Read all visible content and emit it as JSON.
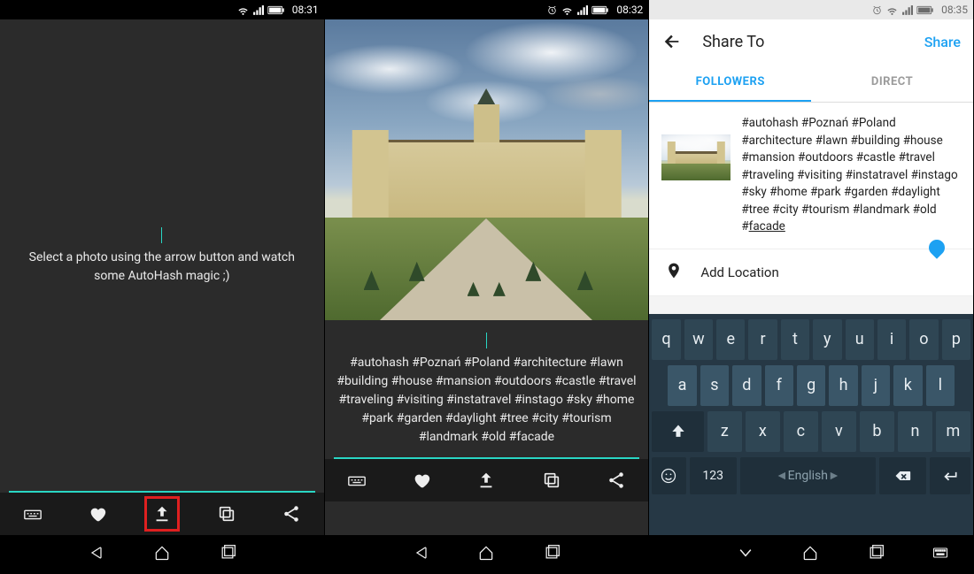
{
  "screens": [
    {
      "status": {
        "time": "08:31",
        "icons": [
          "wifi-icon",
          "signal-icon",
          "battery-icon"
        ]
      },
      "caption": "Select a photo using the arrow button and watch some AutoHash magic ;)",
      "toolbar": [
        "keyboard",
        "favorite",
        "upload",
        "copy",
        "share"
      ],
      "upload_highlighted": true
    },
    {
      "status": {
        "time": "08:32",
        "icons": [
          "alarm-icon",
          "wifi-icon",
          "signal-icon",
          "battery-icon"
        ]
      },
      "caption": "#autohash #Poznań #Poland #architecture #lawn #building #house #mansion #outdoors #castle #travel #traveling #visiting #instatravel #instago #sky #home #park #garden #daylight #tree #city #tourism #landmark #old #facade",
      "toolbar": [
        "keyboard",
        "favorite",
        "upload",
        "copy",
        "share"
      ]
    },
    {
      "status": {
        "time": "08:35",
        "icons": [
          "alarm-icon",
          "wifi-icon",
          "signal-icon",
          "battery-icon"
        ]
      },
      "appbar": {
        "title": "Share To",
        "action": "Share"
      },
      "tabs": {
        "followers": "FOLLOWERS",
        "direct": "DIRECT",
        "active": "followers"
      },
      "caption": "#autohash #Poznań #Poland #architecture #lawn #building #house #mansion #outdoors #castle #travel #traveling #visiting #instatravel #instago #sky #home #park #garden #daylight #tree #city #tourism #landmark #old #",
      "caption_last_word": "facade",
      "location_label": "Add Location",
      "keyboard": {
        "row1": [
          "q",
          "w",
          "e",
          "r",
          "t",
          "y",
          "u",
          "i",
          "o",
          "p"
        ],
        "row2": [
          "a",
          "s",
          "d",
          "f",
          "g",
          "h",
          "j",
          "k",
          "l"
        ],
        "row3": [
          "z",
          "x",
          "c",
          "v",
          "b",
          "n",
          "m"
        ],
        "row4": {
          "numeric": "123",
          "space": "English"
        }
      }
    }
  ]
}
